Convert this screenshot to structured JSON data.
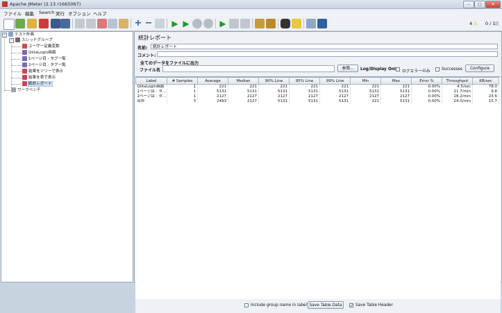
{
  "window": {
    "title": "Apache JMeter (2.13 r1665067)"
  },
  "menu": [
    "ファイル",
    "編集",
    "Search",
    "実行",
    "オプション",
    "ヘルプ"
  ],
  "status": {
    "warnings": "4",
    "threads": "0 / 1"
  },
  "tree": [
    {
      "label": "テスト計画"
    },
    {
      "label": "スレッドグループ"
    },
    {
      "label": "ユーザー定義変数"
    },
    {
      "label": "QiitaLogin画面"
    },
    {
      "label": "1ページ目 - タグ一覧"
    },
    {
      "label": "2ページ目 - タグ一覧"
    },
    {
      "label": "結果をツリーで表示"
    },
    {
      "label": "結果を表で表示"
    },
    {
      "label": "統計レポート"
    },
    {
      "label": "ワークベンチ"
    }
  ],
  "panel": {
    "title": "統計レポート",
    "name_label": "名前:",
    "name_value": "統計レポート",
    "comment_label": "コメント:",
    "comment_value": "",
    "section": "全てのデータをファイルに出力",
    "file_label": "ファイル名",
    "browse": "参照...",
    "log_display": "Log/Display Only:",
    "errors_only": "ログエラーのみ",
    "successes": "Successes",
    "configure": "Configure"
  },
  "table": {
    "headers": [
      "Label",
      "# Samples",
      "Average",
      "Median",
      "90% Line",
      "95% Line",
      "99% Line",
      "Min",
      "Max",
      "Error %",
      "Throughput",
      "KB/sec"
    ],
    "rows": [
      [
        "QiitaLogin画面",
        "1",
        "221",
        "221",
        "221",
        "221",
        "221",
        "221",
        "221",
        "0.00%",
        "4.5/sec",
        "78.0"
      ],
      [
        "1ページ目 - タ...",
        "1",
        "5131",
        "5131",
        "5131",
        "5131",
        "5131",
        "5131",
        "5131",
        "0.00%",
        "11.7/min",
        "9.8"
      ],
      [
        "2ページ目 - タ...",
        "1",
        "2127",
        "2127",
        "2127",
        "2127",
        "2127",
        "2127",
        "2127",
        "0.00%",
        "28.2/min",
        "23.6"
      ],
      [
        "合計",
        "3",
        "2493",
        "2127",
        "5131",
        "5131",
        "5131",
        "221",
        "5131",
        "0.00%",
        "24.0/min",
        "15.7"
      ]
    ]
  },
  "bottom": {
    "include_group": "Include group name in label?",
    "save_table": "Save Table Data",
    "save_header": "Save Table Header"
  }
}
